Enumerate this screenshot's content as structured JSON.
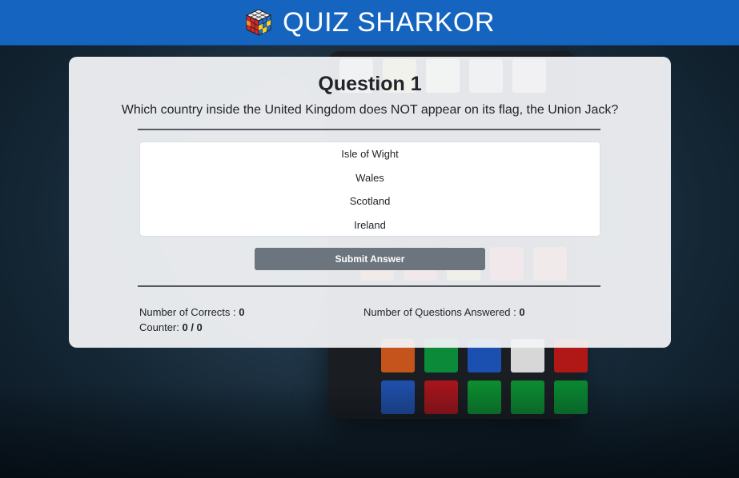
{
  "header": {
    "title": "QUIZ SHARKOR",
    "logo_icon": "rubiks-cube-icon"
  },
  "question": {
    "title": "Question 1",
    "text": "Which country inside the United Kingdom does NOT appear on its flag, the Union Jack?"
  },
  "options": [
    "Isle of Wight",
    "Wales",
    "Scotland",
    "Ireland"
  ],
  "submit_label": "Submit Answer",
  "stats": {
    "corrects_label": "Number of Corrects : ",
    "corrects_value": "0",
    "answered_label": "Number of Questions Answered : ",
    "answered_value": "0",
    "counter_label": "Counter: ",
    "counter_value": "0 / 0"
  },
  "colors": {
    "header_bg": "#1565c0",
    "button_bg": "#6c757d",
    "card_bg": "#f2f3f5"
  }
}
